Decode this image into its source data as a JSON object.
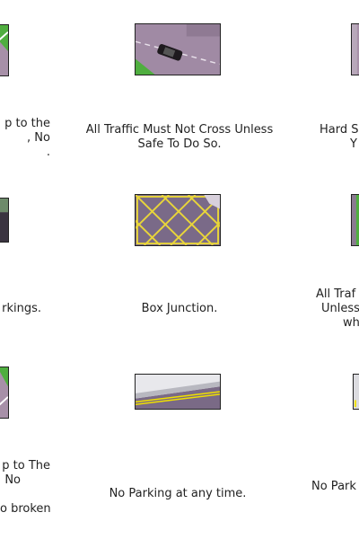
{
  "cards": {
    "left_top": {
      "lines": [
        "p to the",
        ", No",
        "."
      ]
    },
    "middle_top": {
      "lines": [
        "All Traffic Must Not Cross Unless",
        "Safe To Do So."
      ]
    },
    "right_top": {
      "lines": [
        "Hard S",
        "Y"
      ]
    },
    "left_middle": {
      "lines": [
        "rkings."
      ]
    },
    "middle_middle": {
      "lines": [
        "Box Junction."
      ]
    },
    "right_middle": {
      "lines": [
        "All Traf",
        "Unless",
        "wh"
      ]
    },
    "left_bottom": {
      "lines": [
        "p to The",
        "No",
        "",
        "o broken"
      ]
    },
    "middle_bottom": {
      "lines": [
        "No Parking at any time."
      ]
    },
    "right_bottom": {
      "lines": [
        "No Park"
      ]
    }
  },
  "colors": {
    "road": "#a790a8",
    "grass": "#4fae3f",
    "box_yellow": "#e8d53a",
    "line_yellow": "#f0e000"
  }
}
